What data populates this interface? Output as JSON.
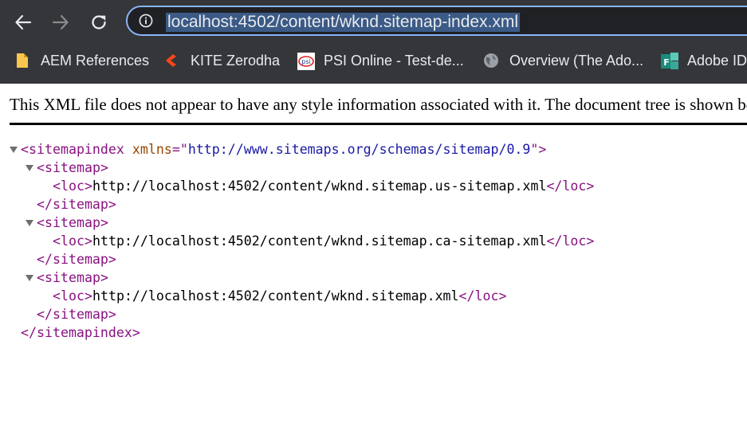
{
  "browser": {
    "url": "localhost:4502/content/wknd.sitemap-index.xml",
    "accent_color": "#8ab4f8",
    "nav": {
      "back_icon": "arrow-left-icon",
      "forward_icon": "arrow-right-icon",
      "reload_icon": "reload-icon",
      "site_info_icon": "info-icon"
    }
  },
  "bookmarks": [
    {
      "label": "AEM References",
      "icon": "folder-icon"
    },
    {
      "label": "KITE Zerodha",
      "icon": "kite-logo-icon"
    },
    {
      "label": "PSI Online - Test-de...",
      "icon": "psi-logo-icon"
    },
    {
      "label": "Overview (The Ado...",
      "icon": "globe-icon"
    },
    {
      "label": "Adobe ID",
      "icon": "adobe-fms-icon"
    }
  ],
  "page": {
    "notice": "This XML file does not appear to have any style information associated with it. The document tree is shown below.",
    "xml": {
      "root_tag": "sitemapindex",
      "root_attr_name": "xmlns",
      "root_attr_value": "http://www.sitemaps.org/schemas/sitemap/0.9",
      "child_tag": "sitemap",
      "loc_tag": "loc",
      "locs": [
        "http://localhost:4502/content/wknd.sitemap.us-sitemap.xml",
        "http://localhost:4502/content/wknd.sitemap.ca-sitemap.xml",
        "http://localhost:4502/content/wknd.sitemap.xml"
      ]
    }
  }
}
